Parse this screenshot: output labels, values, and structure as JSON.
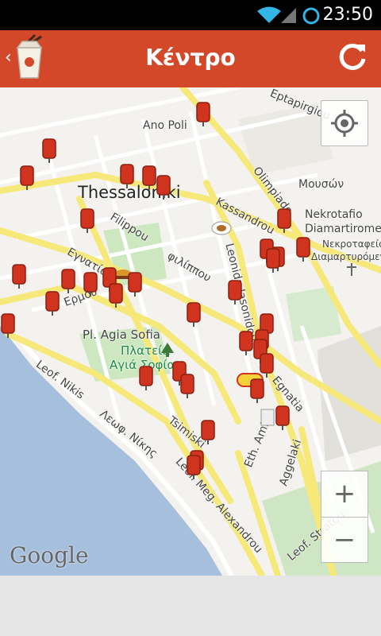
{
  "status_bar": {
    "time": "23:50"
  },
  "action_bar": {
    "title": "Κέντρο"
  },
  "map": {
    "labels": {
      "ano_poli": "Ano Poli",
      "eptapirgiou": "Eptapirgiou",
      "thessaloniki": "Thessaloniki",
      "olimpiados": "Olimpiado",
      "mouson": "Μουσών",
      "kassandrou": "Kassandrou",
      "nekrotafio": "Nekrotafio",
      "diamartiromenon": "Diamartiromen",
      "nekrotafeio_gr": "Νεκροταφείο",
      "diamartyromenon_gr": "Διαμαρτυρόμενων",
      "filippou": "Filippou",
      "filippou_gr": "φιλίππου",
      "egnatia_gr": "Εγνατία",
      "ermou_gr": "Ερμού",
      "leonida_iasonidou": "Leonida Iasonidou",
      "pl_agia_sofia": "Pl. Agia Sofia",
      "plateia_gr": "Πλατεία",
      "agia_sofia_gr": "Αγιά Σοφία",
      "leof_nikis": "Leof. Nikis",
      "leof_nikis_gr": "Λεωφ. Νίκης",
      "tsimiski": "Tsimiski",
      "leof_meg_alexandrou": "Leof. Meg. Alexandrou",
      "egnatia": "Egnatia",
      "eth_aminis": "Eth. Amini",
      "aggelaki": "Aggelaki",
      "leof_stratou": "Leof. Stratou"
    },
    "zoom_in_label": "+",
    "zoom_out_label": "−",
    "attribution": "Google",
    "pin_color": "#d0341e"
  }
}
